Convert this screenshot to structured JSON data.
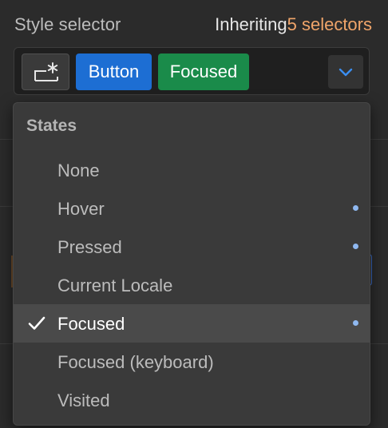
{
  "header": {
    "title": "Style selector",
    "inheriting_label": "Inheriting",
    "inheriting_count": "5 selectors"
  },
  "selector": {
    "class_tag": "Button",
    "state_tag": "Focused",
    "icons": {
      "new_selector": "new-selector-icon",
      "open_dropdown": "chevron-down-icon"
    }
  },
  "states_menu": {
    "title": "States",
    "items": [
      {
        "label": "None",
        "selected": false,
        "has_styles": false
      },
      {
        "label": "Hover",
        "selected": false,
        "has_styles": true
      },
      {
        "label": "Pressed",
        "selected": false,
        "has_styles": true
      },
      {
        "label": "Current Locale",
        "selected": false,
        "has_styles": false
      },
      {
        "label": "Focused",
        "selected": true,
        "has_styles": true
      },
      {
        "label": "Focused (keyboard)",
        "selected": false,
        "has_styles": false
      },
      {
        "label": "Visited",
        "selected": false,
        "has_styles": false
      }
    ]
  },
  "colors": {
    "class_tag_bg": "#1d6ed3",
    "state_tag_bg": "#1a8b4a",
    "count_accent": "#f0a56a",
    "style_dot": "#8fb8f0"
  }
}
